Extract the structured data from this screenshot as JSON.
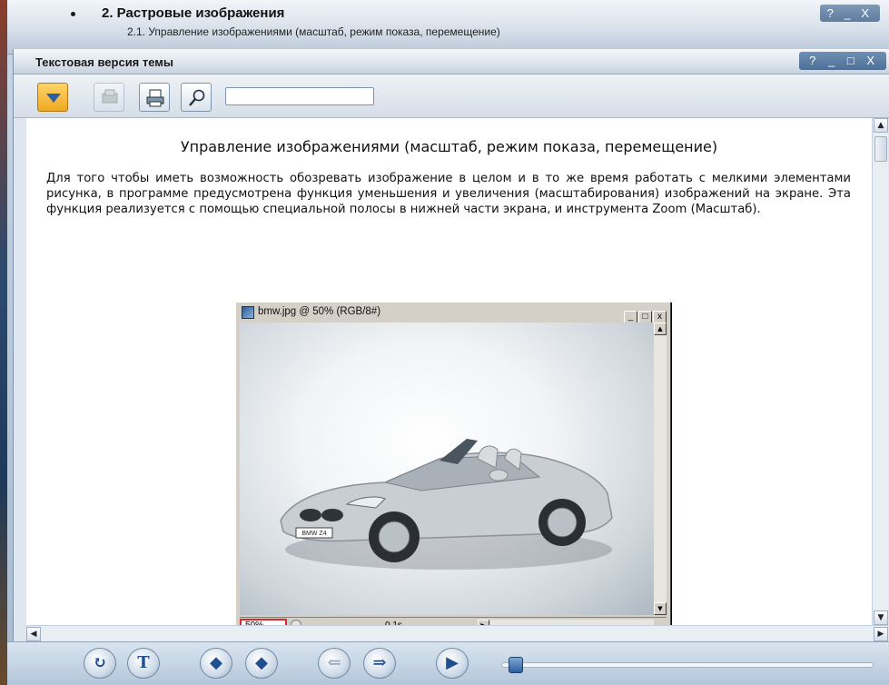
{
  "outer_window": {
    "title": "2. Растровые изображения",
    "subtitle": "2.1. Управление изображениями (масштаб, режим показа, перемещение)",
    "controls": "? _ X"
  },
  "inner_window": {
    "title": "Текстовая версия темы",
    "controls": "? _ □ X"
  },
  "toolbar": {
    "search_value": ""
  },
  "content": {
    "heading": "Управление изображениями (масштаб, режим показа, перемещение)",
    "paragraph": "Для того чтобы иметь возможность обозревать изображение в целом и в то же время работать с мелкими элементами рисунка, в программе предусмотрена функция уменьшения и увеличения (масштабирования) изображений на экране. Эта функция реализуется с помощью специальной полосы в нижней части экрана, и инструмента Zoom (Масштаб)."
  },
  "ps_window": {
    "title": "bmw.jpg @ 50% (RGB/8#)",
    "min_label": "_",
    "max_label": "□",
    "close_label": "x",
    "zoom_value": "50%",
    "timing": "0,1s",
    "plate": "BMW Z4"
  },
  "player": {
    "refresh": "↻",
    "text_mode": "T",
    "prev": "◆",
    "next": "◆",
    "back_disabled": "⇐",
    "forward": "⇒",
    "play": "▶",
    "progress": 0.02
  },
  "colors": {
    "accent": "#f0a920",
    "highlight": "#d92b2b",
    "nav_blue": "#1f4f8f"
  }
}
